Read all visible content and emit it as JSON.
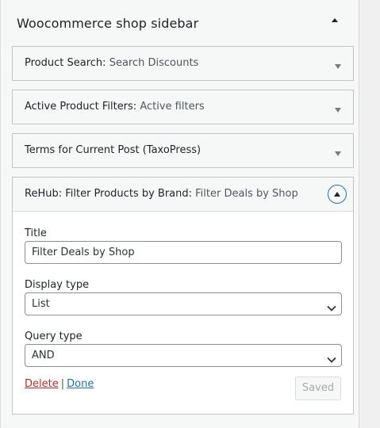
{
  "sidebar": {
    "title": "Woocommerce shop sidebar"
  },
  "widgets": [
    {
      "name": "Product Search:",
      "subtitle": "Search Discounts"
    },
    {
      "name": "Active Product Filters:",
      "subtitle": "Active filters"
    },
    {
      "name": "Terms for Current Post (TaxoPress)",
      "subtitle": ""
    },
    {
      "name": "ReHub: Filter Products by Brand:",
      "subtitle": "Filter Deals by Shop"
    }
  ],
  "form": {
    "title_label": "Title",
    "title_value": "Filter Deals by Shop",
    "display_type_label": "Display type",
    "display_type_value": "List",
    "query_type_label": "Query type",
    "query_type_value": "AND",
    "delete_label": "Delete",
    "separator": "|",
    "done_label": "Done",
    "saved_label": "Saved"
  },
  "colors": {
    "accent": "#2271b1",
    "delete": "#b32d2e"
  }
}
